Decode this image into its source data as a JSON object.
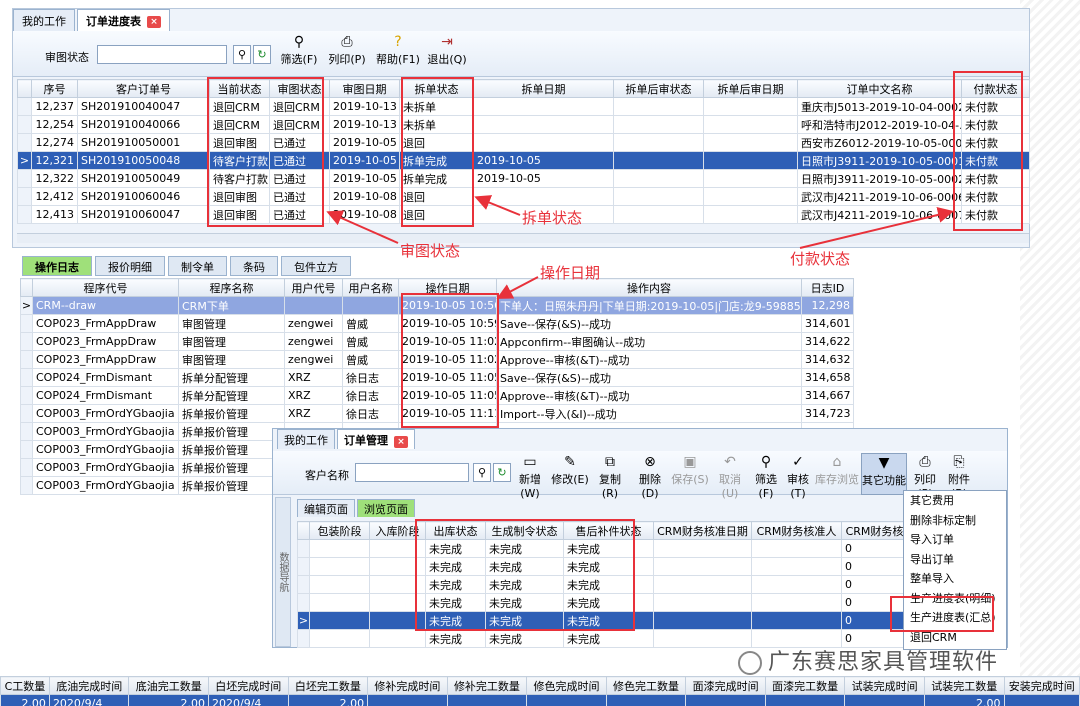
{
  "win1": {
    "tabs": [
      "我的工作",
      "订单进度表"
    ],
    "filter_label": "审图状态",
    "buttons": [
      {
        "label": "筛选(F)",
        "icon": "binoculars-icon"
      },
      {
        "label": "列印(P)",
        "icon": "printer-icon"
      },
      {
        "label": "帮助(F1)",
        "icon": "help-icon"
      },
      {
        "label": "退出(Q)",
        "icon": "exit-icon"
      }
    ],
    "columns": [
      "序号",
      "客户订单号",
      "当前状态",
      "审图状态",
      "审图日期",
      "拆单状态",
      "拆单日期",
      "拆单后审状态",
      "拆单后审日期",
      "订单中文名称",
      "付款状态"
    ],
    "rows": [
      [
        "12,237",
        "SH201910040047",
        "退回CRM",
        "退回CRM",
        "2019-10-13",
        "未拆单",
        "",
        "",
        "",
        "重庆市J5013-2019-10-04-0002...",
        "未付款"
      ],
      [
        "12,254",
        "SH201910040066",
        "退回CRM",
        "退回CRM",
        "2019-10-13",
        "未拆单",
        "",
        "",
        "",
        "呼和浩特市J2012-2019-10-04-...",
        "未付款"
      ],
      [
        "12,274",
        "SH201910050001",
        "退回审图",
        "已通过",
        "2019-10-05",
        "退回",
        "",
        "",
        "",
        "西安市Z6012-2019-10-05-0001...",
        "未付款"
      ],
      [
        "12,321",
        "SH201910050048",
        "待客户打款",
        "已通过",
        "2019-10-05",
        "拆单完成",
        "2019-10-05",
        "",
        "",
        "日照市J3911-2019-10-05-0001...",
        "未付款"
      ],
      [
        "12,322",
        "SH201910050049",
        "待客户打款",
        "已通过",
        "2019-10-05",
        "拆单完成",
        "2019-10-05",
        "",
        "",
        "日照市J3911-2019-10-05-0002...",
        "未付款"
      ],
      [
        "12,412",
        "SH201910060046",
        "退回审图",
        "已通过",
        "2019-10-08",
        "退回",
        "",
        "",
        "",
        "武汉市J4211-2019-10-06-0006...",
        "未付款"
      ],
      [
        "12,413",
        "SH201910060047",
        "退回审图",
        "已通过",
        "2019-10-08",
        "退回",
        "",
        "",
        "",
        "武汉市J4211-2019-10-06-0007...",
        "未付款"
      ]
    ]
  },
  "tabs2": [
    "操作日志",
    "报价明细",
    "制令单",
    "条码",
    "包件立方"
  ],
  "log": {
    "columns": [
      "程序代号",
      "程序名称",
      "用户代号",
      "用户名称",
      "操作日期",
      "操作内容",
      "日志ID"
    ],
    "rows": [
      [
        "CRM--draw",
        "CRM下单",
        "",
        "",
        "2019-10-05 10:56",
        "下单人：日照朱丹丹|下单日期:2019-10-05|门店:龙9-598852...",
        "12,298"
      ],
      [
        "COP023_FrmAppDraw",
        "审图管理",
        "zengwei",
        "曾威",
        "2019-10-05 10:59",
        "Save--保存(&S)--成功",
        "314,601"
      ],
      [
        "COP023_FrmAppDraw",
        "审图管理",
        "zengwei",
        "曾威",
        "2019-10-05 11:02",
        "Appconfirm--审图确认--成功",
        "314,622"
      ],
      [
        "COP023_FrmAppDraw",
        "审图管理",
        "zengwei",
        "曾威",
        "2019-10-05 11:02",
        "Approve--审核(&T)--成功",
        "314,632"
      ],
      [
        "COP024_FrmDismant",
        "拆单分配管理",
        "XRZ",
        "徐日志",
        "2019-10-05 11:05",
        "Save--保存(&S)--成功",
        "314,658"
      ],
      [
        "COP024_FrmDismant",
        "拆单分配管理",
        "XRZ",
        "徐日志",
        "2019-10-05 11:05",
        "Approve--审核(&T)--成功",
        "314,667"
      ],
      [
        "COP003_FrmOrdYGbaojia",
        "拆单报价管理",
        "XRZ",
        "徐日志",
        "2019-10-05 11:11",
        "Import--导入(&I)--成功",
        "314,723"
      ],
      [
        "COP003_FrmOrdYGbaojia",
        "拆单报价管理",
        "",
        "",
        "",
        "",
        ""
      ],
      [
        "COP003_FrmOrdYGbaojia",
        "拆单报价管理",
        "",
        "",
        "",
        "",
        ""
      ],
      [
        "COP003_FrmOrdYGbaojia",
        "拆单报价管理",
        "",
        "",
        "",
        "",
        ""
      ],
      [
        "COP003_FrmOrdYGbaojia",
        "拆单报价管理",
        "",
        "",
        "",
        "",
        ""
      ]
    ]
  },
  "win2": {
    "tabs": [
      "我的工作",
      "订单管理"
    ],
    "filter_label": "客户名称",
    "buttons": [
      "新增(W)",
      "修改(E)",
      "复制(R)",
      "删除(D)",
      "保存(S)",
      "取消(U)",
      "筛选(F)",
      "审核(T)",
      "库存浏览",
      "其它功能",
      "列印(P)",
      "附件(B)"
    ],
    "subtabs": [
      "编辑页面",
      "浏览页面"
    ],
    "side_label": "数据导航",
    "columns": [
      "包装阶段",
      "入库阶段",
      "出库状态",
      "生成制令状态",
      "售后补件状态",
      "CRM财务核准日期",
      "CRM财务核准人",
      "CRM财务核"
    ],
    "rows": [
      [
        "",
        "",
        "未完成",
        "未完成",
        "未完成",
        "",
        "",
        "0"
      ],
      [
        "",
        "",
        "未完成",
        "未完成",
        "未完成",
        "",
        "",
        "0"
      ],
      [
        "",
        "",
        "未完成",
        "未完成",
        "未完成",
        "",
        "",
        "0"
      ],
      [
        "",
        "",
        "未完成",
        "未完成",
        "未完成",
        "",
        "",
        "0"
      ],
      [
        "",
        "",
        "未完成",
        "未完成",
        "未完成",
        "",
        "",
        "0"
      ],
      [
        "",
        "",
        "未完成",
        "未完成",
        "未完成",
        "",
        "",
        "0"
      ]
    ],
    "menu": [
      "其它费用",
      "删除非标定制",
      "导入订单",
      "导出订单",
      "整单导入",
      "生产进度表(明细)",
      "生产进度表(汇总)",
      "退回CRM"
    ]
  },
  "annotations": {
    "review": "审图状态",
    "split": "拆单状态",
    "opdate": "操作日期",
    "pay": "付款状态"
  },
  "bottom": {
    "columns": [
      "C工数量",
      "底油完成时间",
      "底油完工数量",
      "白坯完成时间",
      "白坯完工数量",
      "修补完成时间",
      "修补完工数量",
      "修色完成时间",
      "修色完工数量",
      "面漆完成时间",
      "面漆完工数量",
      "试装完成时间",
      "试装完工数量",
      "安装完成时间"
    ],
    "row": [
      "2.00",
      "2020/9/4",
      "2.00",
      "2020/9/4",
      "2.00",
      "",
      "",
      "",
      "",
      "",
      "",
      "",
      "2.00",
      ""
    ]
  },
  "watermark": "广东赛思家具管理软件",
  "colors": {
    "selected_row": "#2e5fb6",
    "annotation": "#e8313a",
    "active_tab": "#9fe07a"
  }
}
